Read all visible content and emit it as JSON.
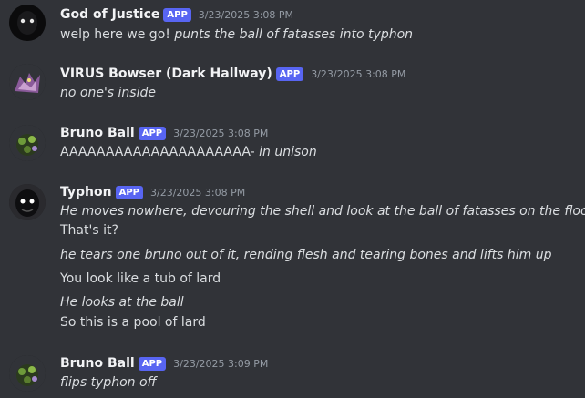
{
  "badge": "APP",
  "messages": [
    {
      "username": "God of Justice",
      "timestamp": "3/23/2025 3:08 PM",
      "avatar_icon": "dark-masked-figure-avatar",
      "lines": [
        {
          "plain": "welp here we go! ",
          "italic": "punts the ball of fatasses into typhon"
        }
      ]
    },
    {
      "username": "VIRUS Bowser (Dark Hallway)",
      "timestamp": "3/23/2025 3:08 PM",
      "avatar_icon": "purple-creature-avatar",
      "lines": [
        {
          "plain": "",
          "italic": "no one's inside"
        }
      ]
    },
    {
      "username": "Bruno Ball",
      "timestamp": "3/23/2025 3:08 PM",
      "avatar_icon": "green-ball-creature-avatar",
      "lines": [
        {
          "plain": "AAAAAAAAAAAAAAAAAAAAA- ",
          "italic": "in unison"
        }
      ]
    },
    {
      "username": "Typhon",
      "timestamp": "3/23/2025 3:08 PM",
      "avatar_icon": "shadow-face-avatar",
      "lines": [
        {
          "plain": "",
          "italic": "He moves nowhere, devouring the shell and look at the ball of fatasses on the floor"
        },
        {
          "plain": "That's it?",
          "italic": ""
        },
        {
          "plain": "",
          "italic": "he tears one bruno out of it, rending flesh and tearing bones and lifts him up"
        },
        {
          "plain": "You look like a tub of lard",
          "italic": ""
        },
        {
          "plain": "",
          "italic": "He looks at the ball"
        },
        {
          "plain": "So this is a pool of lard",
          "italic": ""
        }
      ]
    },
    {
      "username": "Bruno Ball",
      "timestamp": "3/23/2025 3:09 PM",
      "avatar_icon": "green-ball-creature-avatar",
      "lines": [
        {
          "plain": "",
          "italic": "flips typhon off"
        }
      ]
    }
  ]
}
